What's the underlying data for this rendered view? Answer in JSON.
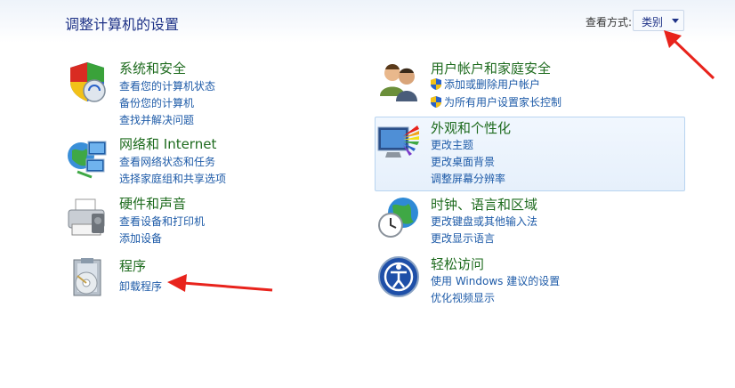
{
  "header": {
    "title": "调整计算机的设置",
    "view_by_label": "查看方式:",
    "view_by_value": "类别"
  },
  "categories": [
    {
      "title": "系统和安全",
      "icon": "shield-icon",
      "links": [
        "查看您的计算机状态",
        "备份您的计算机",
        "查找并解决问题"
      ]
    },
    {
      "title": "网络和 Internet",
      "icon": "network-icon",
      "links": [
        "查看网络状态和任务",
        "选择家庭组和共享选项"
      ]
    },
    {
      "title": "硬件和声音",
      "icon": "printer-icon",
      "links": [
        "查看设备和打印机",
        "添加设备"
      ]
    },
    {
      "title": "程序",
      "icon": "programs-icon",
      "links": [
        "卸载程序"
      ]
    },
    {
      "title": "用户帐户和家庭安全",
      "icon": "users-icon",
      "links": [
        "添加或删除用户帐户",
        "为所有用户设置家长控制"
      ]
    },
    {
      "title": "外观和个性化",
      "icon": "appearance-icon",
      "links": [
        "更改主题",
        "更改桌面背景",
        "调整屏幕分辨率"
      ]
    },
    {
      "title": "时钟、语言和区域",
      "icon": "clock-globe-icon",
      "links": [
        "更改键盘或其他输入法",
        "更改显示语言"
      ]
    },
    {
      "title": "轻松访问",
      "icon": "ease-of-access-icon",
      "links": [
        "使用 Windows 建议的设置",
        "优化视频显示"
      ]
    }
  ],
  "colors": {
    "title_blue": "#1e3287",
    "category_green": "#1e6b1e",
    "link_blue": "#1e5ba8",
    "annotation_red": "#e8231c"
  }
}
